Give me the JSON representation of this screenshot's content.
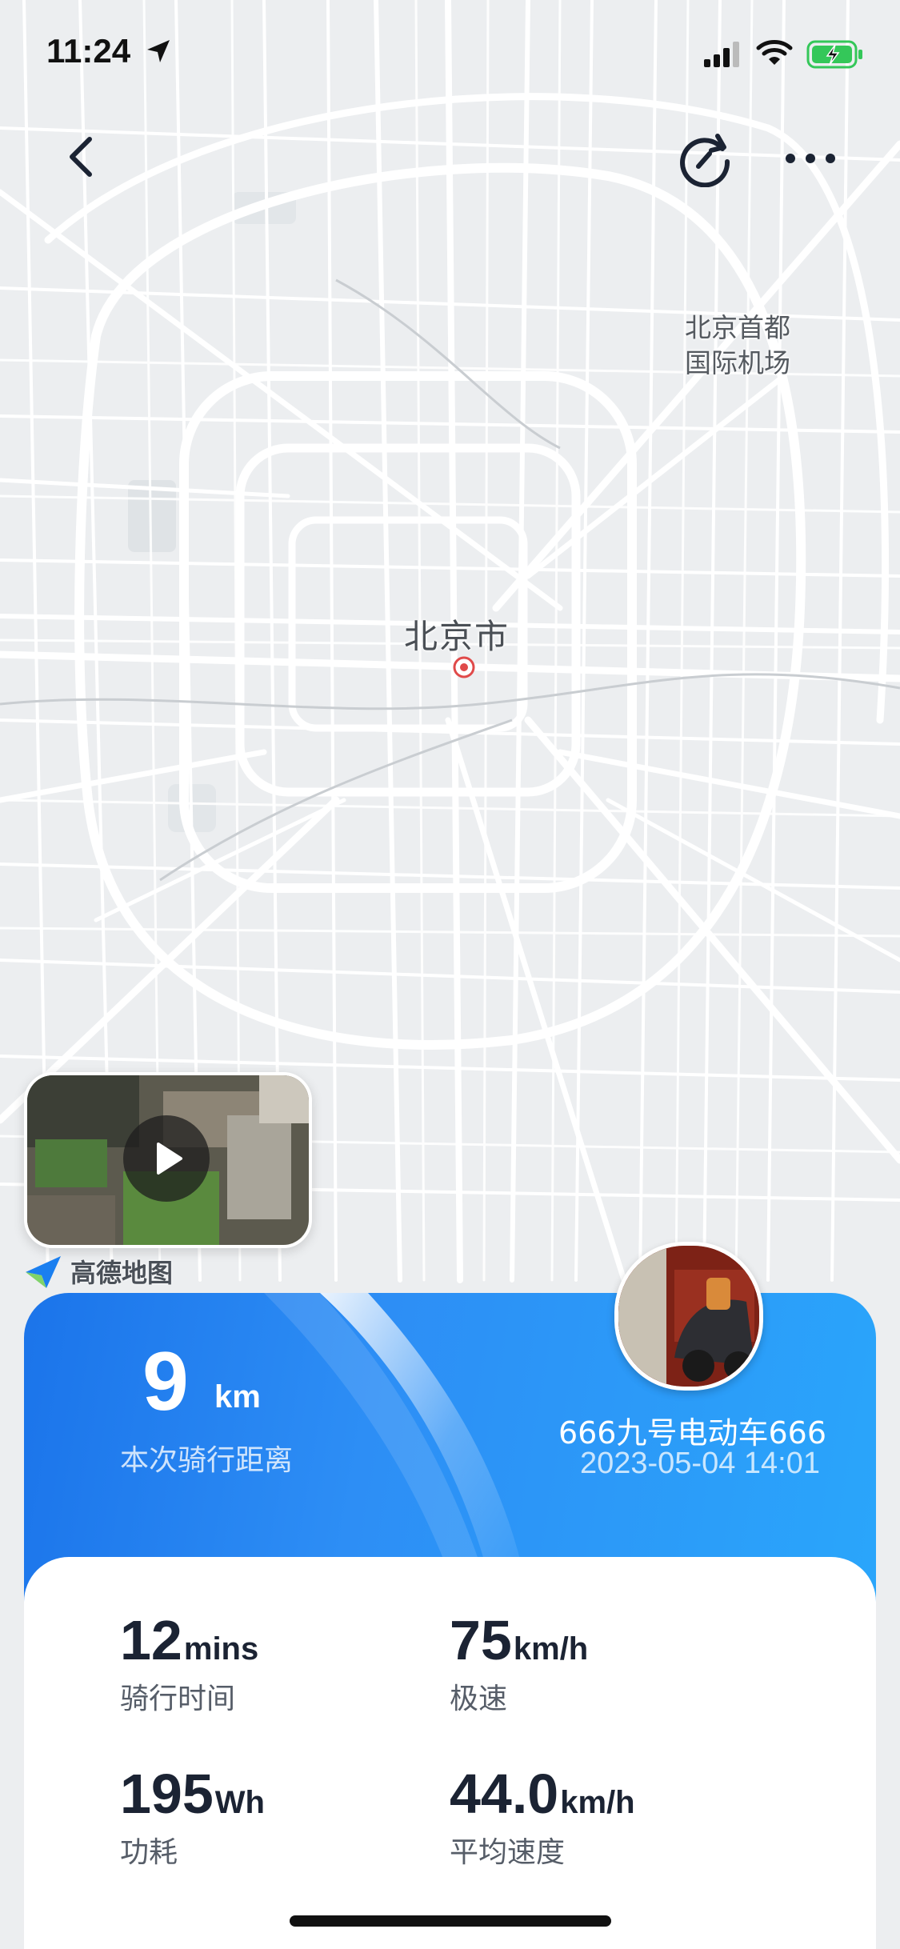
{
  "status_bar": {
    "time": "11:24"
  },
  "map": {
    "city_label": "北京市",
    "airport_label_line1": "北京首都",
    "airport_label_line2": "国际机场",
    "provider": "高德地图"
  },
  "ride": {
    "distance_value": "9",
    "distance_unit": "km",
    "distance_label": "本次骑行距离",
    "vehicle_name": "666九号电动车666",
    "date": "2023-05-04 14:01"
  },
  "stats": [
    {
      "value": "12",
      "unit": "mins",
      "label": "骑行时间"
    },
    {
      "value": "75",
      "unit": "km/h",
      "label": "极速"
    },
    {
      "value": "195",
      "unit": "Wh",
      "label": "功耗"
    },
    {
      "value": "44.0",
      "unit": "km/h",
      "label": "平均速度"
    }
  ],
  "colors": {
    "card_blue_start": "#1b74ea",
    "card_blue_end": "#2aa6fb",
    "battery_green": "#34c759",
    "text_dark": "#1b2333"
  },
  "icons": {
    "back": "chevron-left-icon",
    "refresh": "refresh-icon",
    "more": "more-icon",
    "play": "play-icon",
    "pin": "location-pin-icon"
  }
}
